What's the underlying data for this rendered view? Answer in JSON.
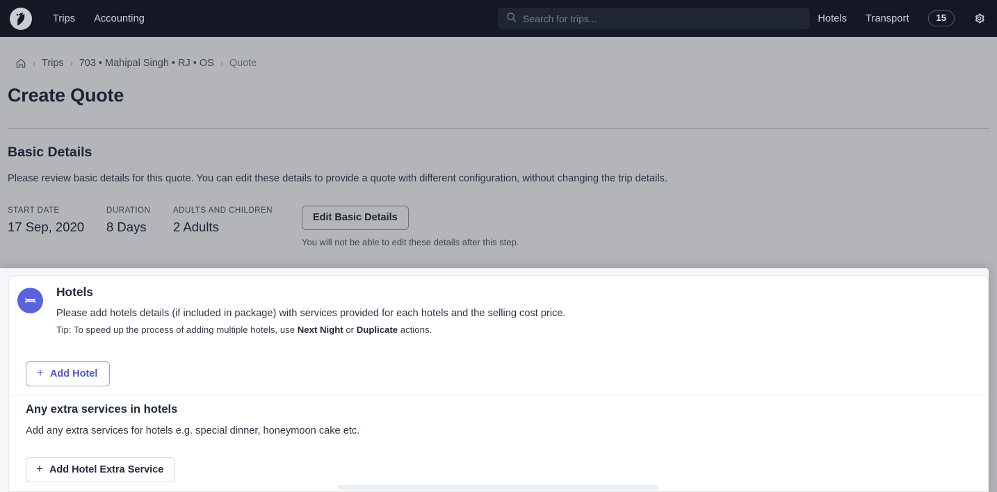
{
  "topnav": {
    "logo_icon": "company-logo-bird-icon",
    "links": [
      {
        "label": "Trips"
      },
      {
        "label": "Accounting"
      }
    ],
    "search": {
      "icon": "search-icon",
      "placeholder": "Search for trips...",
      "value": ""
    },
    "right_links": [
      {
        "label": "Hotels"
      },
      {
        "label": "Transport"
      }
    ],
    "badge": "15",
    "settings_icon": "gear-icon",
    "bar_color": "#141824"
  },
  "breadcrumb": {
    "home_icon": "home-icon",
    "separator": "›",
    "items": [
      {
        "label": "Trips",
        "current": false
      },
      {
        "label": "703 • Mahipal Singh • RJ • OS",
        "current": false
      },
      {
        "label": "Quote",
        "current": true
      }
    ]
  },
  "page": {
    "title": "Create Quote"
  },
  "basic_details": {
    "heading": "Basic Details",
    "description": "Please review basic details for this quote. You can edit these details to provide a quote with different configuration, without changing the trip details.",
    "fields": [
      {
        "label": "START DATE",
        "value": "17 Sep, 2020"
      },
      {
        "label": "DURATION",
        "value": "8 Days"
      },
      {
        "label": "ADULTS AND CHILDREN",
        "value": "2 Adults"
      }
    ],
    "edit_button": "Edit Basic Details",
    "edit_note": "You will not be able to edit these details after this step."
  },
  "hotels_panel": {
    "icon": "bed-icon",
    "accent_color": "#5a63db",
    "title": "Hotels",
    "description": "Please add hotels details (if included in package) with services provided for each hotels and the selling cost price.",
    "tip_prefix": "Tip: To speed up the process of adding multiple hotels, use ",
    "tip_bold_1": "Next Night",
    "tip_middle": " or ",
    "tip_bold_2": "Duplicate",
    "tip_suffix": " actions.",
    "add_hotel_button": "Add Hotel",
    "plus_glyph": "+",
    "extra": {
      "title": "Any extra services in hotels",
      "description": "Add any extra services for hotels e.g. special dinner, honeymoon cake etc.",
      "add_button": "Add Hotel Extra Service"
    }
  }
}
